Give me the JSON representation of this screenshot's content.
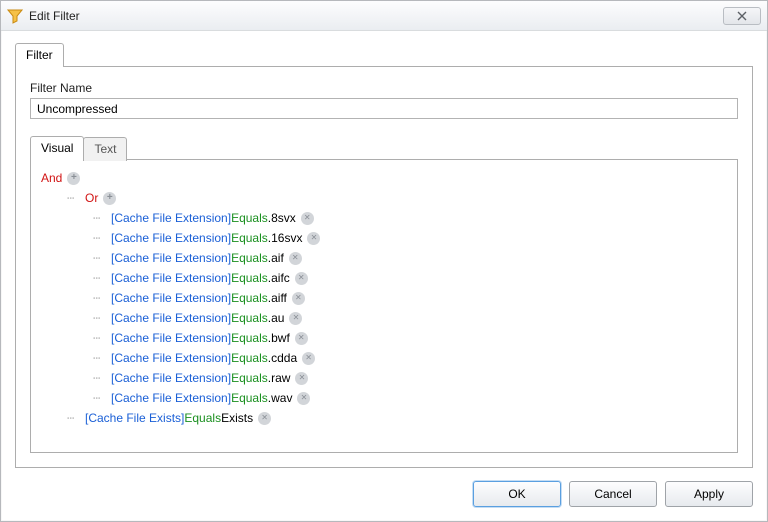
{
  "window": {
    "title": "Edit Filter"
  },
  "outer_tab": {
    "label": "Filter"
  },
  "filter_name": {
    "label": "Filter Name",
    "value": "Uncompressed"
  },
  "inner_tabs": {
    "visual": "Visual",
    "text": "Text"
  },
  "tree": {
    "root_op": "And",
    "child_op": "Or",
    "rules": [
      {
        "field": "[Cache File Extension]",
        "verb": "Equals",
        "value": ".8svx"
      },
      {
        "field": "[Cache File Extension]",
        "verb": "Equals",
        "value": ".16svx"
      },
      {
        "field": "[Cache File Extension]",
        "verb": "Equals",
        "value": ".aif"
      },
      {
        "field": "[Cache File Extension]",
        "verb": "Equals",
        "value": ".aifc"
      },
      {
        "field": "[Cache File Extension]",
        "verb": "Equals",
        "value": ".aiff"
      },
      {
        "field": "[Cache File Extension]",
        "verb": "Equals",
        "value": ".au"
      },
      {
        "field": "[Cache File Extension]",
        "verb": "Equals",
        "value": ".bwf"
      },
      {
        "field": "[Cache File Extension]",
        "verb": "Equals",
        "value": ".cdda"
      },
      {
        "field": "[Cache File Extension]",
        "verb": "Equals",
        "value": ".raw"
      },
      {
        "field": "[Cache File Extension]",
        "verb": "Equals",
        "value": ".wav"
      }
    ],
    "final_rule": {
      "field": "[Cache File Exists]",
      "verb": "Equals",
      "value": "Exists"
    }
  },
  "buttons": {
    "ok": "OK",
    "cancel": "Cancel",
    "apply": "Apply"
  }
}
